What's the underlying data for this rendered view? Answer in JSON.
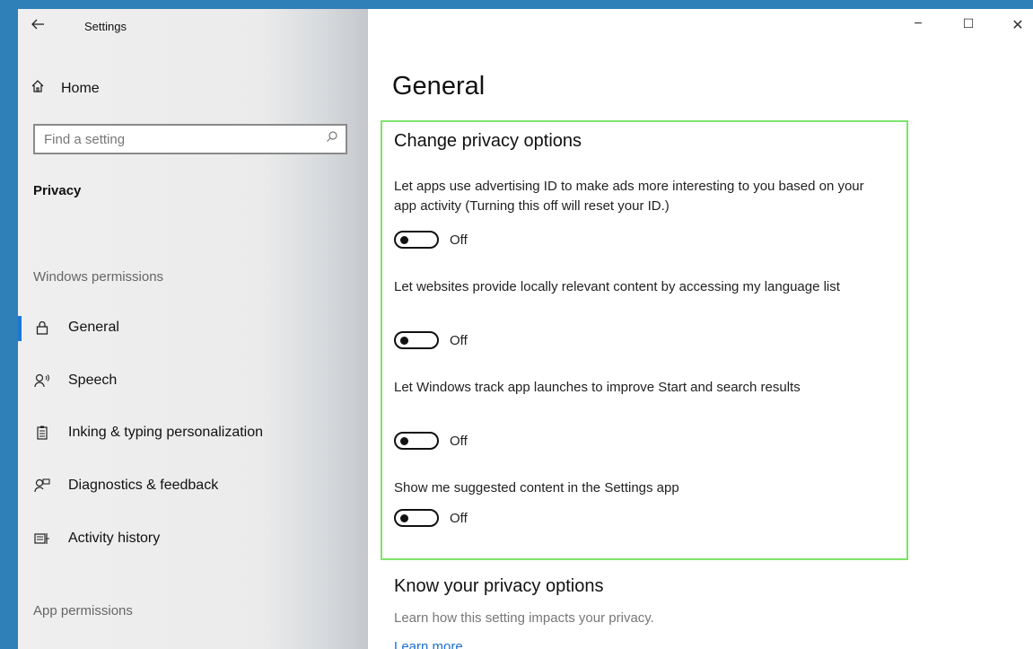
{
  "window": {
    "title": "Settings",
    "controls": {
      "minimize": "−",
      "maximize": "☐",
      "close": "✕"
    }
  },
  "sidebar": {
    "home_label": "Home",
    "search": {
      "placeholder": "Find a setting"
    },
    "category": "Privacy",
    "windows_permissions_label": "Windows permissions",
    "items": [
      {
        "label": "General",
        "icon": "lock-icon",
        "selected": true
      },
      {
        "label": "Speech",
        "icon": "speech-icon",
        "selected": false
      },
      {
        "label": "Inking & typing personalization",
        "icon": "inking-icon",
        "selected": false
      },
      {
        "label": "Diagnostics & feedback",
        "icon": "feedback-icon",
        "selected": false
      },
      {
        "label": "Activity history",
        "icon": "activity-history-icon",
        "selected": false
      }
    ],
    "app_permissions_label": "App permissions"
  },
  "main": {
    "title": "General",
    "change_section": {
      "heading": "Change privacy options",
      "options": [
        {
          "text": "Let apps use advertising ID to make ads more interesting to you based on your app activity (Turning this off will reset your ID.)",
          "state": "Off"
        },
        {
          "text": "Let websites provide locally relevant content by accessing my language list",
          "state": "Off"
        },
        {
          "text": "Let Windows track app launches to improve Start and search results",
          "state": "Off"
        },
        {
          "text": "Show me suggested content in the Settings app",
          "state": "Off"
        }
      ]
    },
    "know_section": {
      "heading": "Know your privacy options",
      "subtext": "Learn how this setting impacts your privacy.",
      "link": "Learn more"
    }
  },
  "colors": {
    "accent": "#1f76d2",
    "highlight_box": "#7de36a",
    "desktop": "#2f7fb8"
  }
}
